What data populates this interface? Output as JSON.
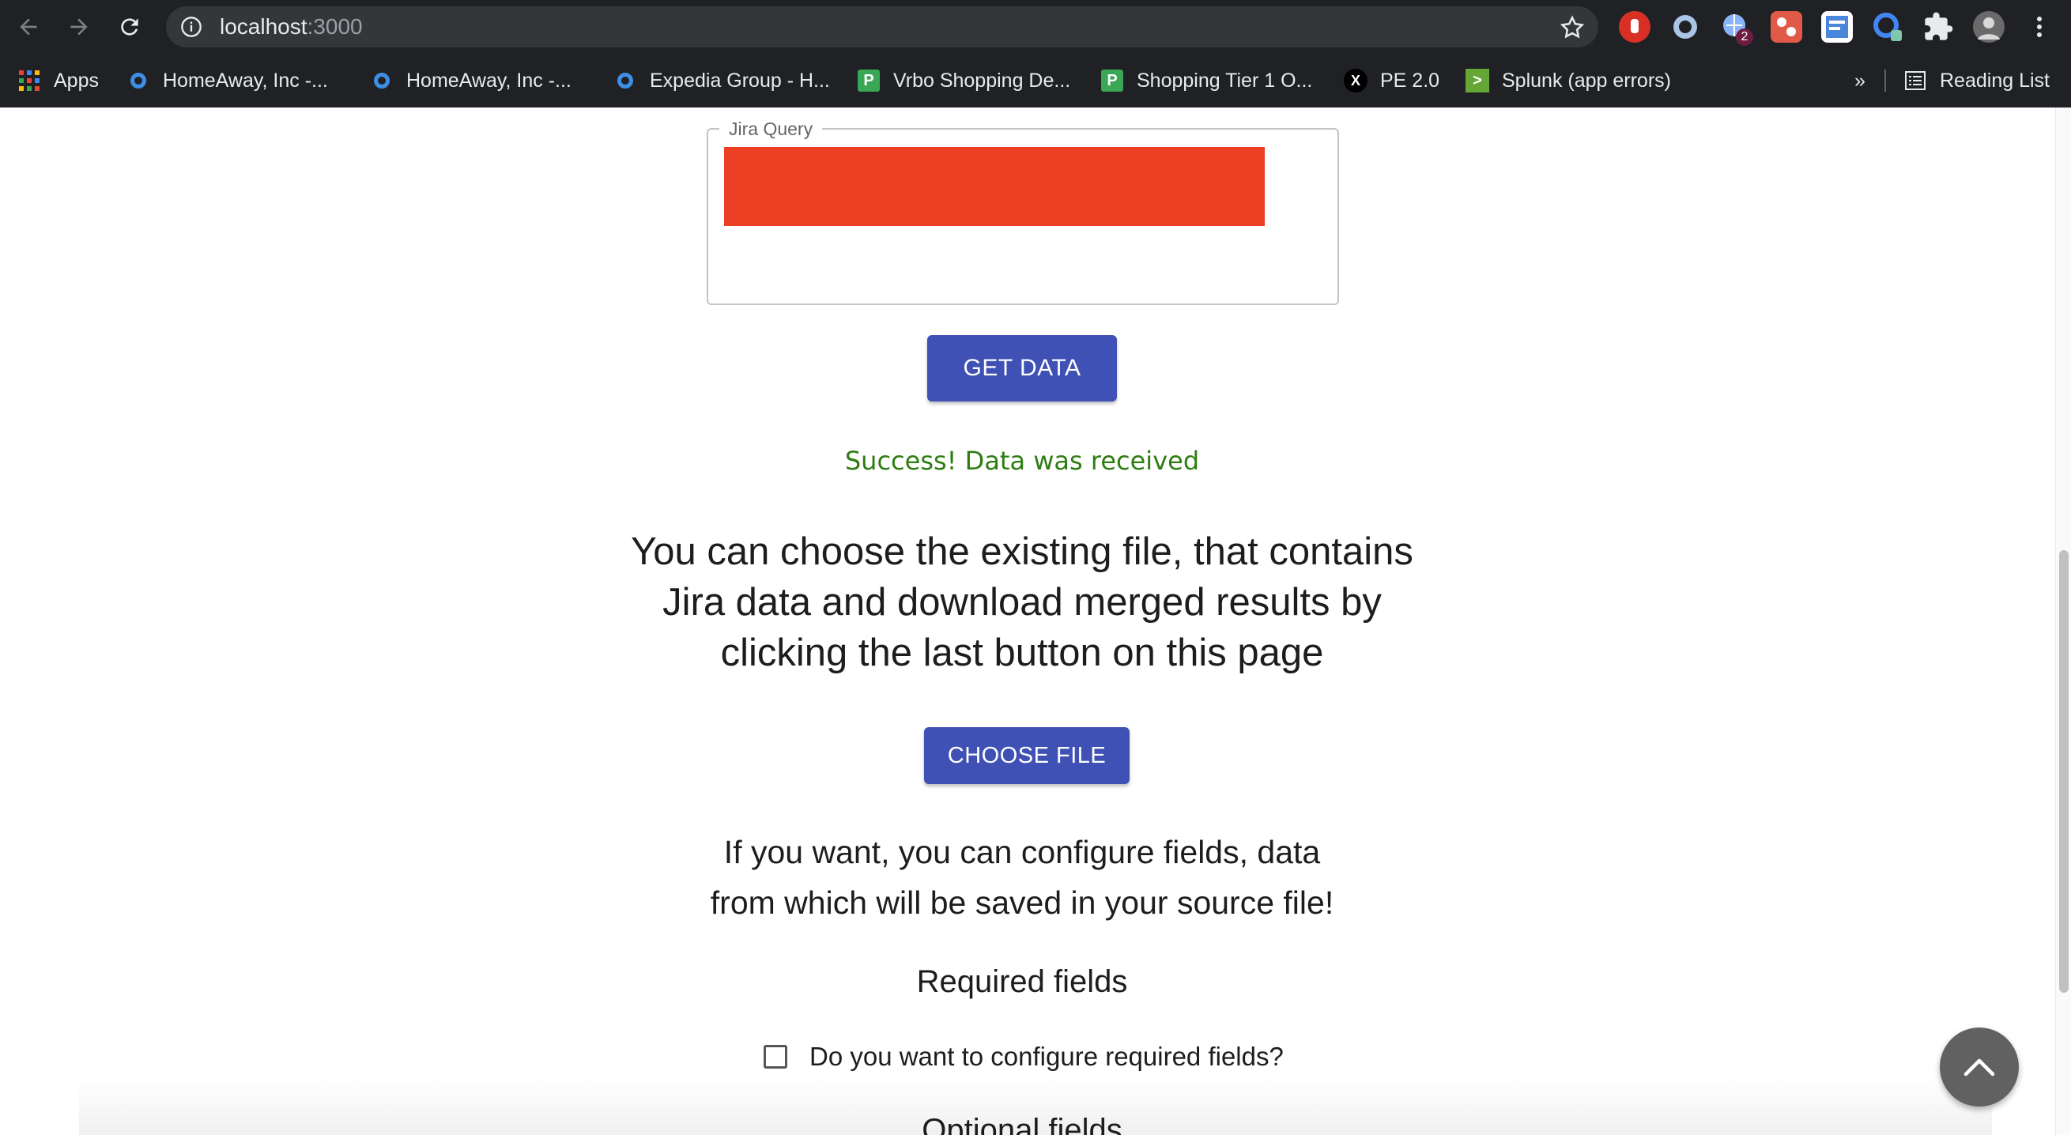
{
  "browser": {
    "url_host": "localhost",
    "url_port": ":3000",
    "extensions": [
      {
        "name": "stop-hand-icon",
        "color": "#d93025"
      },
      {
        "name": "circle-extension-icon",
        "color": "#8ab4f8"
      },
      {
        "name": "globe-extension-icon",
        "color": "#8ab4f8",
        "badge": "2"
      },
      {
        "name": "red-pattern-extension-icon",
        "color": "#e05a47"
      },
      {
        "name": "document-extension-icon",
        "color": "#4a86d9"
      },
      {
        "name": "blue-ring-extension-icon",
        "color": "#4285f4"
      }
    ]
  },
  "bookmarks": {
    "apps_label": "Apps",
    "items": [
      {
        "label": "HomeAway, Inc -...",
        "icon": "ring"
      },
      {
        "label": "HomeAway, Inc -...",
        "icon": "ring"
      },
      {
        "label": "Expedia Group - H...",
        "icon": "ring"
      },
      {
        "label": "Vrbo Shopping De...",
        "icon": "p",
        "glyph": "P"
      },
      {
        "label": "Shopping Tier 1 O...",
        "icon": "p",
        "glyph": "P"
      },
      {
        "label": "PE 2.0",
        "icon": "x",
        "glyph": "X"
      },
      {
        "label": "Splunk (app errors)",
        "icon": "splunk",
        "glyph": ">"
      }
    ],
    "more": "»",
    "reading_list": "Reading List"
  },
  "page": {
    "jira_query_label": "Jira Query",
    "get_data_button": "GET DATA",
    "success_message": "Success! Data was received",
    "choose_file_lines": [
      "You can choose the existing file, that contains",
      "Jira data and download merged results by",
      "clicking the last button on this page"
    ],
    "choose_file_button": "CHOOSE FILE",
    "configure_lines": [
      "If you want, you can configure fields, data",
      "from which will be saved in your source file!"
    ],
    "required_fields_heading": "Required fields",
    "required_checkbox_label": "Do you want to configure required fields?",
    "required_checkbox_checked": false,
    "optional_fields_heading": "Optional fields"
  },
  "colors": {
    "primary_button": "#3f51b5",
    "success_text": "#2e7d12",
    "redaction": "#ec3f24"
  }
}
